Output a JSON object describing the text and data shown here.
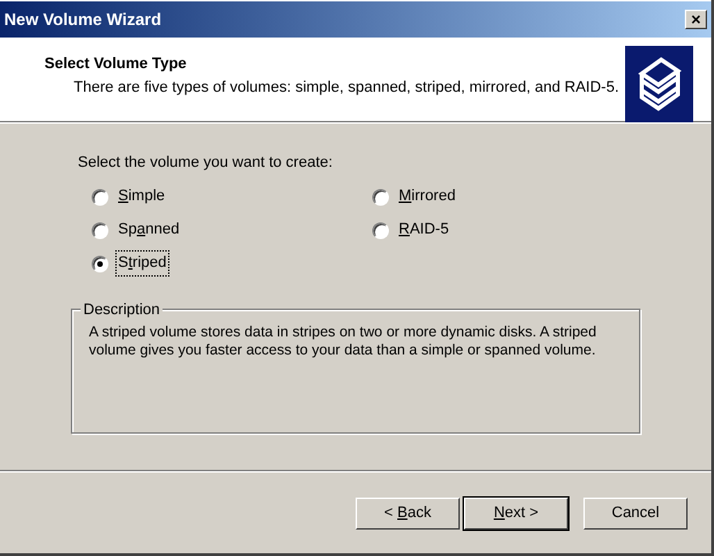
{
  "window": {
    "title": "New Volume Wizard",
    "close_button": "×"
  },
  "header": {
    "title": "Select Volume Type",
    "subtitle": "There are five types of volumes: simple, spanned, striped, mirrored, and RAID-5."
  },
  "prompt": "Select the volume you want to create:",
  "options": [
    {
      "key": "S",
      "post": "imple",
      "selected": false,
      "focused": false
    },
    {
      "key": "M",
      "post": "irrored",
      "selected": false,
      "focused": false
    },
    {
      "pre": "Sp",
      "key": "a",
      "post": "nned",
      "selected": false,
      "focused": false
    },
    {
      "key": "R",
      "post": "AID-5",
      "selected": false,
      "focused": false
    },
    {
      "pre": "S",
      "key": "t",
      "post": "riped",
      "selected": true,
      "focused": true
    }
  ],
  "description": {
    "title": "Description",
    "text": "A striped volume stores data in stripes on two or more dynamic disks. A striped volume gives you faster access to your data than a simple or spanned volume."
  },
  "buttons": [
    {
      "pre": "< ",
      "key": "B",
      "post": "ack",
      "default": false
    },
    {
      "key": "N",
      "post": "ext >",
      "default": true
    },
    {
      "pre": "Cancel",
      "default": false
    }
  ]
}
